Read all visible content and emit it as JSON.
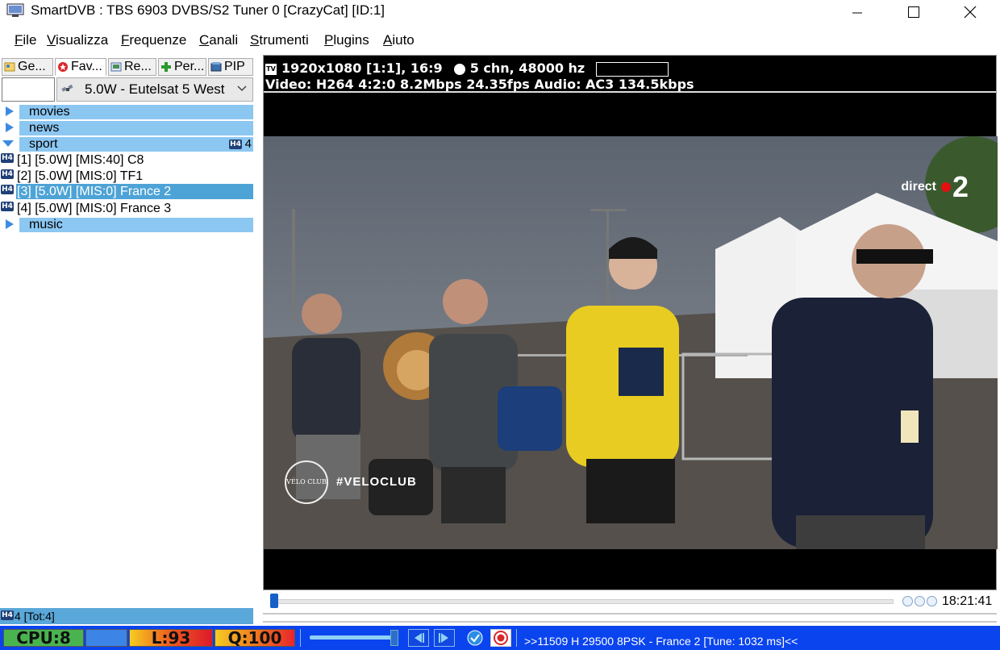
{
  "window": {
    "title": "SmartDVB : TBS 6903 DVBS/S2 Tuner 0 [CrazyCat] [ID:1]"
  },
  "menu": [
    "File",
    "Visualizza",
    "Frequenze",
    "Canali",
    "Strumenti",
    "Plugins",
    "Aiuto"
  ],
  "tabs": [
    {
      "label": "Ge...",
      "icon": "guide-icon"
    },
    {
      "label": "Fav...",
      "icon": "favorites-icon"
    },
    {
      "label": "Re...",
      "icon": "recordings-icon"
    },
    {
      "label": "Per...",
      "icon": "plus-icon"
    },
    {
      "label": "PIP",
      "icon": "pip-icon"
    }
  ],
  "satellite": {
    "selected": "5.0W -  Eutelsat 5 West",
    "search_value": ""
  },
  "groups": {
    "movies": "movies",
    "news": "news",
    "sport": "sport",
    "sport_count": "4",
    "music": "music"
  },
  "channels": [
    {
      "label": "[1] [5.0W]  [MIS:40] C8"
    },
    {
      "label": "[2] [5.0W]  [MIS:0] TF1"
    },
    {
      "label": "[3] [5.0W]  [MIS:0] France 2"
    },
    {
      "label": "[4] [5.0W]  [MIS:0] France 3"
    }
  ],
  "badge_text": "H4",
  "left_footer": "4 [Tot:4]",
  "osd": {
    "tv_icon": "TV",
    "resolution": "1920x1080 [1:1], 16:9",
    "audio_channels": "5 chn, 48000 hz",
    "video_line": "Video: H264 4:2:0 8.2Mbps 24.35fps   Audio: AC3 134.5kbps"
  },
  "video": {
    "watermark_text": "direct",
    "watermark_number": "2",
    "velo_logo": "VÉLO CLUB",
    "hashtag": "#VELOCLUB"
  },
  "seek": {
    "time": "18:21:41"
  },
  "status": {
    "cpu": "CPU:8",
    "level": "L:93",
    "quality": "Q:100",
    "tuning": ">>11509 H 29500 8PSK - France 2 [Tune: 1032 ms]<<"
  },
  "colors": {
    "group_bar": "#8cc7f2",
    "selected_channel": "#4ea3d6",
    "status_bar": "#0a44ee",
    "cpu_meter": "#49b44f",
    "level_meter": "#ee5a1f",
    "quality_meter": "#f08a1f"
  }
}
